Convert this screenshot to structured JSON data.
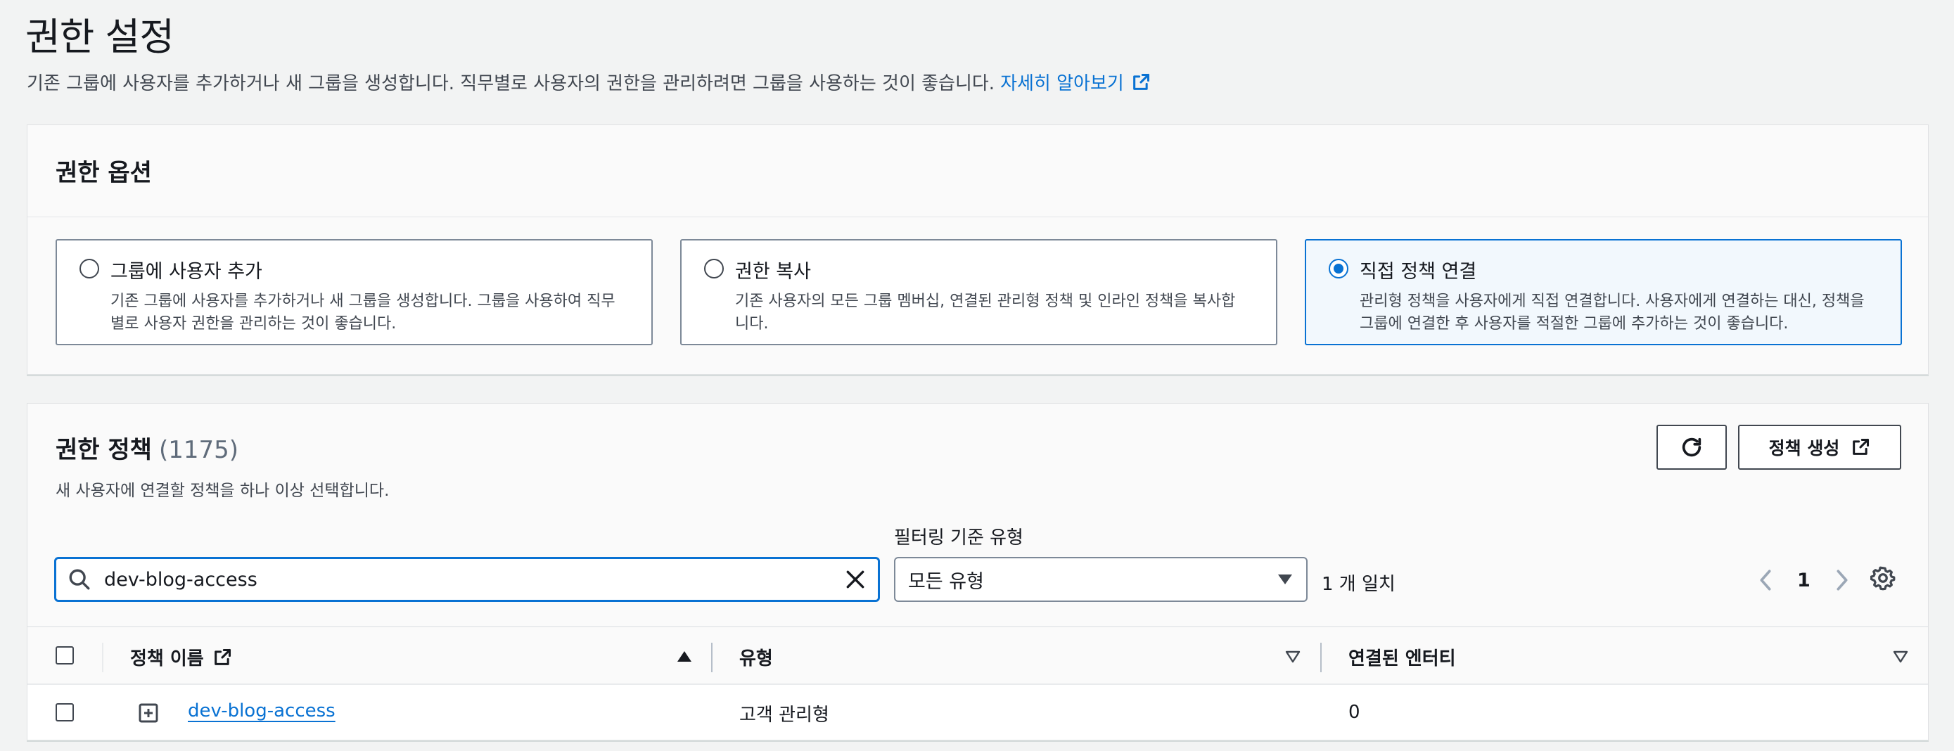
{
  "header": {
    "title": "권한 설정",
    "description": "기존 그룹에 사용자를 추가하거나 새 그룹을 생성합니다. 직무별로 사용자의 권한을 관리하려면 그룹을 사용하는 것이 좋습니다.",
    "learn_more": "자세히 알아보기"
  },
  "permission_options": {
    "title": "권한 옵션",
    "options": [
      {
        "label": "그룹에 사용자 추가",
        "description": "기존 그룹에 사용자를 추가하거나 새 그룹을 생성합니다. 그룹을 사용하여 직무별로 사용자 권한을 관리하는 것이 좋습니다.",
        "selected": false
      },
      {
        "label": "권한 복사",
        "description": "기존 사용자의 모든 그룹 멤버십, 연결된 관리형 정책 및 인라인 정책을 복사합니다.",
        "selected": false
      },
      {
        "label": "직접 정책 연결",
        "description": "관리형 정책을 사용자에게 직접 연결합니다. 사용자에게 연결하는 대신, 정책을 그룹에 연결한 후 사용자를 적절한 그룹에 추가하는 것이 좋습니다.",
        "selected": true
      }
    ]
  },
  "policies": {
    "title": "권한 정책",
    "count": "(1175)",
    "subtitle": "새 사용자에 연결할 정책을 하나 이상 선택합니다.",
    "create_button": "정책 생성",
    "search_value": "dev-blog-access",
    "filter_label": "필터링 기준 유형",
    "filter_value": "모든 유형",
    "match_text": "1 개 일치",
    "page": "1",
    "columns": [
      "정책 이름",
      "유형",
      "연결된 엔터티"
    ],
    "rows": [
      {
        "name": "dev-blog-access",
        "type": "고객 관리형",
        "entities": "0"
      }
    ]
  },
  "colors": {
    "accent": "#0972d3",
    "text": "#16191f",
    "background": "#f2f3f3"
  }
}
